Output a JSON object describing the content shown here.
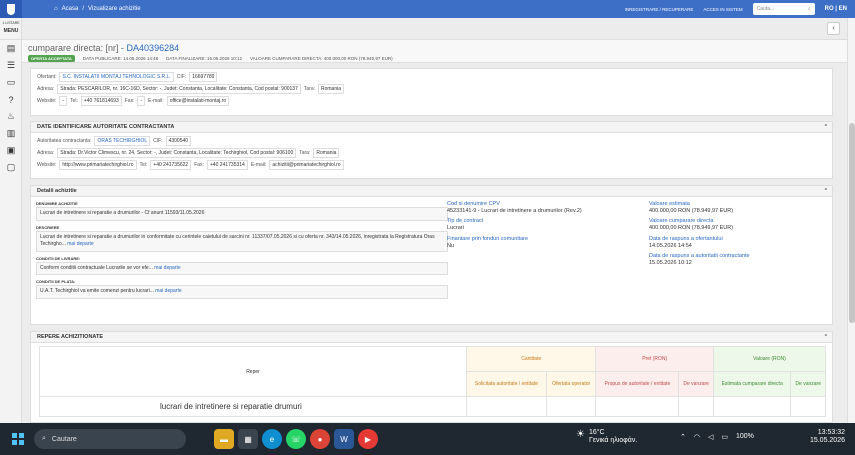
{
  "topbar": {
    "home": "Acasa",
    "sep": "/",
    "page": "Vizualizare achizitie",
    "register": "INREGISTRARE / RECUPERARE",
    "login": "ACCES IN SISTEM",
    "search_placeholder": "Cauta...",
    "lang": "RO | EN"
  },
  "sidebar": {
    "menu_small": "1 LISTARE",
    "menu": "MENU"
  },
  "header": {
    "title_prefix": "cumparare directa: [nr] - ",
    "title_id": "DA40396284",
    "badge": "OFERTA ACCEPTATA",
    "pub": "DATA PUBLICARE: 14.05.2026 14:48",
    "fin": "DATA FINALIZARE: 15.05.2026 10:12",
    "valoare": "VALOARE CUMPARARE DIRECTA: 400.000,00 RON (78.949,97 EUR)"
  },
  "ofertant": {
    "l_ofertant": "Ofertant:",
    "ofertant": "S.C. INSTALATII MONTAJ TEHNOLOGIC S.R.L.",
    "l_cif": "CIF:",
    "cif": "16697789",
    "l_adresa": "Adresa:",
    "adresa": "Strada: PESCARILOR, nr. 16C-16D, Sector: -, Judet: Constanta, Localitate: Constanta, Cod postal: 900137",
    "l_tara": "Tara:",
    "tara": "Romania",
    "l_web": "Website:",
    "web": "-",
    "l_tel": "Tel:",
    "tel": "+40 761814693",
    "l_fax": "Fax:",
    "fax": "-",
    "l_email": "E-mail:",
    "email": "office@instalati-montaj.ro"
  },
  "autoritate": {
    "heading": "DATE IDENTIFICARE AUTORITATE CONTRACTANTA",
    "l_aut": "Autoritatea contractanta:",
    "aut": "ORAS TECHIRGHIOL",
    "l_cif": "CIF:",
    "cif": "4300540",
    "l_adresa": "Adresa:",
    "adresa": "Strada: Dr.Victor Climescu, nr. 24, Sector: -, Judet: Constanta, Localitate: Techirghiol, Cod postal: 906100",
    "l_tara": "Tara:",
    "tara": "Romania",
    "l_web": "Website:",
    "web": "http://www.primariatechirghiol.ro",
    "l_tel": "Tel:",
    "tel": "+40 241735622",
    "l_fax": "Fax:",
    "fax": "+40 241735314",
    "l_email": "E-mail:",
    "email": "achizitii@primariatechirghiol.ro"
  },
  "detalii": {
    "heading": "Detalii achizitie",
    "l_den": "DENUMIRE ACHIZITIE",
    "den": "Lucrari de intretinere si reparatie a drumurilor - Cf anunt 11593/11.05.2026",
    "l_desc": "DESCRIERE",
    "desc": "Lucrari de intretinere si reparatie a drumurilor in conformitate cu cerintele caietului de sarcini nr. 11337/07.05.2026 si cu oferta nr. 343/14.05.2026, inregistrata la Registratura Oras Techirgho...",
    "more": "mai departe",
    "l_livr": "CONDITII DE LIVRARE:",
    "livr": "Conform conditii contractuale Lucrarile se vor efe...",
    "l_plata": "CONDITII DE PLATA:",
    "plata": "U.A.T. Techirghiol va emite comenzi pentru lucrari...",
    "k_cpv": "Cod si denumire CPV",
    "cpv": "45233141-9 - Lucrari de intretinere a drumurilor (Rev.2)",
    "k_tip": "Tip de contract",
    "tip": "Lucrari",
    "k_fin": "Finantare prin fonduri comunitare",
    "fin": "Nu",
    "k_ve": "Valoare estimata",
    "ve": "400.000,00 RON (78.949,97 EUR)",
    "k_vcd": "Valoare cumparare directa",
    "vcd": "400.000,00 RON (78.949,97 EUR)",
    "k_dro": "Data de raspuns a ofertantului",
    "dro": "14.05.2026 14:54",
    "k_drac": "Data de raspuns a autoritatii contractante",
    "drac": "15.05.2026 10:12"
  },
  "repere": {
    "heading": "REPERE ACHIZITIONATE",
    "h_reper": "Reper",
    "h_cant": "Cantitate",
    "h_pret": "Pret (RON)",
    "h_valoare": "Valoare (RON)",
    "c1": "Solicitata autoritate / entitate",
    "c2": "Ofertata operator",
    "c3": "Propus de autoritate / entitate",
    "c4": "De vanzare",
    "c5": "Estimata cumparare directa",
    "c6": "De vanzare",
    "item": "lucrari de intretinere si reparatie drumuri"
  },
  "taskbar": {
    "search": "Cautare",
    "temp": "16°C",
    "weather": "Γενικά ηλιοφάν.",
    "battery": "100%",
    "time": "13:53:32",
    "date": "15.05.2026"
  }
}
